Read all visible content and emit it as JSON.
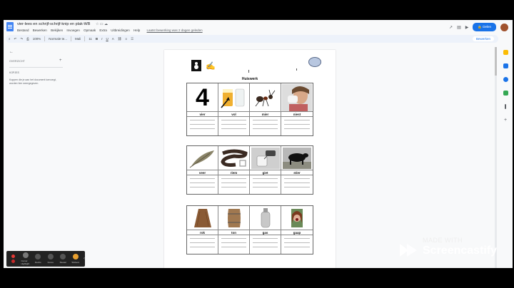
{
  "doc": {
    "title": "vier-lees en schrijf-schrijf-knip en plak-WB",
    "menus": [
      "Bestand",
      "Bewerken",
      "Bekijken",
      "Invoegen",
      "Opmaak",
      "Extra",
      "Uitbreidingen",
      "Help"
    ],
    "last_edit": "Laatst bewerking was 2 dagen geleden",
    "share_label": "Delen"
  },
  "toolbar": {
    "zoom": "100%",
    "style": "Normale te...",
    "font": "Mali",
    "size": "11",
    "edit_mode": "Bewerken"
  },
  "outline": {
    "heading": "OVERZICHT",
    "subheading": "KOPJES",
    "hint": "Koppen die je aan het document toevoegt, worden hier weergegeven."
  },
  "page": {
    "heading": "Huiswerk",
    "cards": [
      {
        "words": [
          "vier",
          "vol",
          "mier",
          "niest"
        ]
      },
      {
        "words": [
          "veer",
          "riem",
          "giet",
          "stier"
        ]
      },
      {
        "words": [
          "rok",
          "ton",
          "gas",
          "gaap"
        ]
      }
    ]
  },
  "screencastify": {
    "buttons": [
      "",
      "Cursor Highlight",
      "Dectto",
      "Focus",
      "Sleutel",
      "Stickers"
    ],
    "made_with": "MADE WITH",
    "brand": "Screencastify"
  },
  "colors": {
    "accent": "#1a73e8",
    "page_bg": "#ffffff",
    "chrome_bg": "#f8f9fa"
  }
}
